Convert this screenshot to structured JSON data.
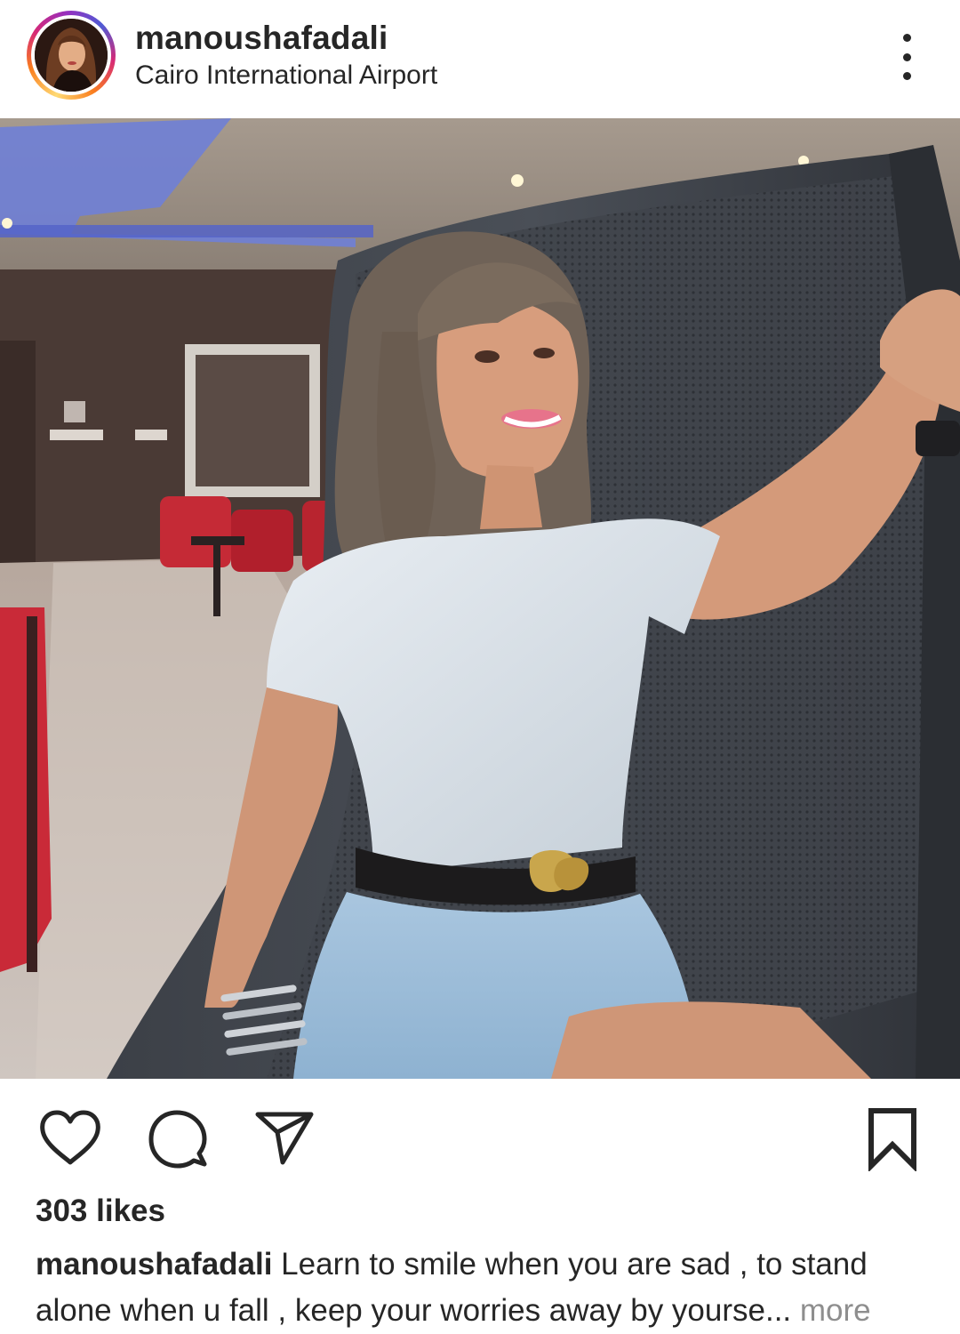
{
  "post": {
    "username": "manoushafadali",
    "location": "Cairo International Airport",
    "likes": "303 likes",
    "caption_user": "manoushafadali",
    "caption_text": " Learn to smile when you are sad , to stand alone when u fall , keep your worries away by yourse...",
    "more_label": " more"
  },
  "icons": {
    "avatar": "profile-avatar",
    "menu": "more-options-icon",
    "like": "heart-icon",
    "comment": "comment-icon",
    "share": "send-icon",
    "save": "bookmark-icon"
  },
  "colors": {
    "text": "#262626",
    "muted": "#8e8e8e",
    "story_ring": [
      "#feda75",
      "#fa7e1e",
      "#d62976",
      "#962fbf",
      "#4f5bd5"
    ]
  }
}
